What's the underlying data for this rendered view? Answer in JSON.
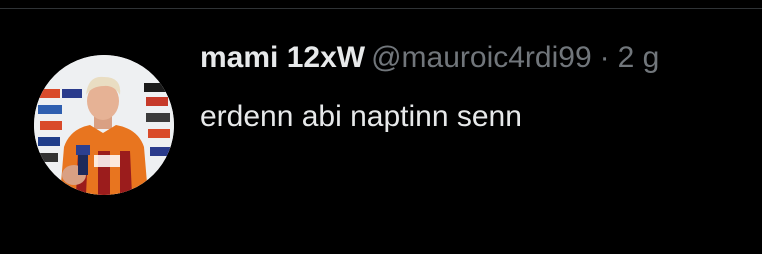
{
  "tweet": {
    "display_name": "mami 12xW",
    "handle": "@mauroic4rdi99",
    "separator": "·",
    "timestamp": "2 g",
    "text": "erdenn abi naptinn senn"
  },
  "colors": {
    "background": "#000000",
    "primary_text": "#e7e9ea",
    "secondary_text": "#71767b",
    "divider": "#2f3336"
  }
}
